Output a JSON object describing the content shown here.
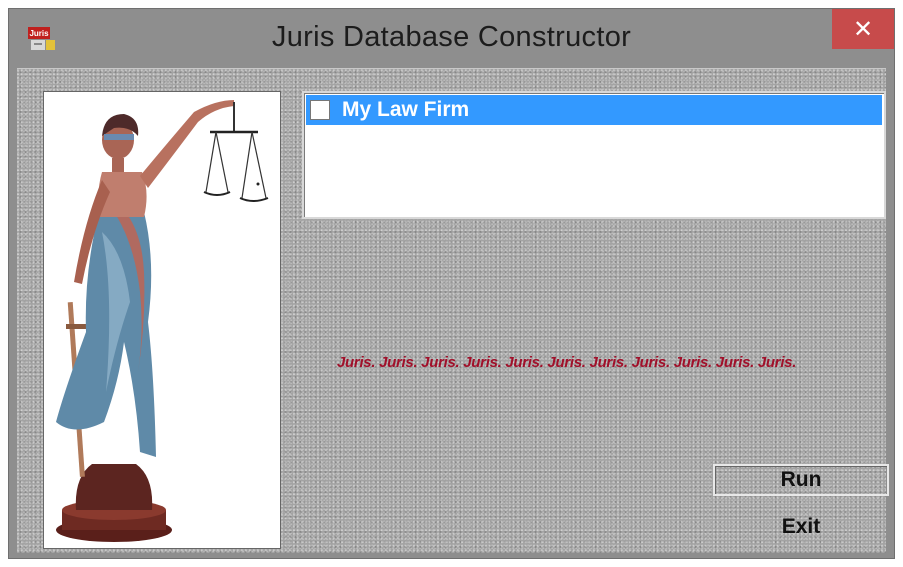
{
  "window": {
    "title": "Juris Database Constructor",
    "close_glyph": "✕",
    "app_icon": "juris-app-icon",
    "app_icon_text": "Juris"
  },
  "image_panel": {
    "subject": "lady-justice-statue"
  },
  "firm_list": {
    "items": [
      {
        "label": "My Law Firm",
        "checked": false,
        "selected": true
      }
    ]
  },
  "marquee": {
    "text": "Juris. Juris. Juris. Juris. Juris. Juris. Juris. Juris. Juris. Juris. Juris."
  },
  "buttons": {
    "run_label": "Run",
    "exit_label": "Exit"
  },
  "colors": {
    "selection": "#3399ff",
    "close_button": "#c74b4b",
    "marquee_text": "#a0102a"
  }
}
